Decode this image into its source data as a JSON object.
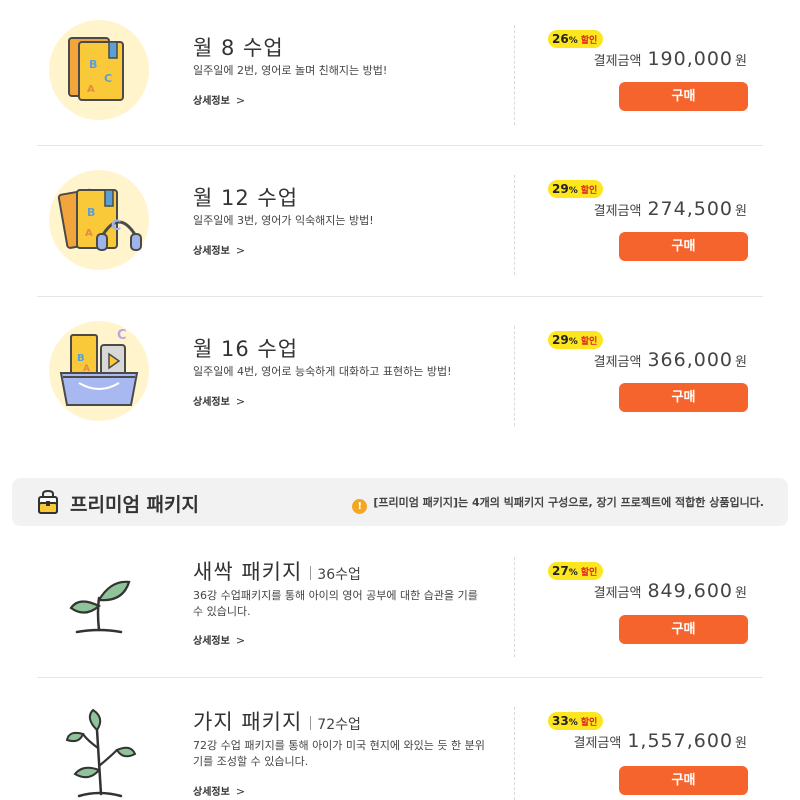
{
  "products": [
    {
      "title": "월 8 수업",
      "description": "일주일에 2번, 영어로 놀며 친해지는 방법!",
      "detail_label": "상세정보",
      "discount_value": "26",
      "discount_unit": "%",
      "discount_label": "할인",
      "price_label": "결제금액",
      "price": "190,000",
      "currency": "원",
      "buy_label": "구매",
      "icon": "books-icon"
    },
    {
      "title": "월 12 수업",
      "description": "일주일에 3번, 영어가 익숙해지는 방법!",
      "detail_label": "상세정보",
      "discount_value": "29",
      "discount_unit": "%",
      "discount_label": "할인",
      "price_label": "결제금액",
      "price": "274,500",
      "currency": "원",
      "buy_label": "구매",
      "icon": "books-headphones-icon"
    },
    {
      "title": "월 16 수업",
      "description": "일주일에 4번, 영어로 능숙하게 대화하고 표현하는 방법!",
      "detail_label": "상세정보",
      "discount_value": "29",
      "discount_unit": "%",
      "discount_label": "할인",
      "price_label": "결제금액",
      "price": "366,000",
      "currency": "원",
      "buy_label": "구매",
      "icon": "learning-basket-icon"
    }
  ],
  "premium": {
    "title": "프리미엄 패키지",
    "notice": "[프리미엄 패키지]는 4개의 빅패키지 구성으로, 장기 프로젝트에 적합한 상품입니다.",
    "icon": "premium-bag-icon",
    "notice_icon": "warning-icon"
  },
  "packages": [
    {
      "title": "새싹 패키지",
      "lessons": "36수업",
      "description": "36강 수업패키지를 통해 아이의 영어 공부에 대한 습관을 기를 수 있습니다.",
      "detail_label": "상세정보",
      "discount_value": "27",
      "discount_unit": "%",
      "discount_label": "할인",
      "price_label": "결제금액",
      "price": "849,600",
      "currency": "원",
      "buy_label": "구매",
      "icon": "sprout-icon"
    },
    {
      "title": "가지 패키지",
      "lessons": "72수업",
      "description": "72강 수업 패키지를 통해 아이가 미국 현지에 와있는 듯 한 분위기를 조성할 수 있습니다.",
      "detail_label": "상세정보",
      "discount_value": "33",
      "discount_unit": "%",
      "discount_label": "할인",
      "price_label": "결제금액",
      "price": "1,557,600",
      "currency": "원",
      "buy_label": "구매",
      "icon": "branch-icon"
    }
  ],
  "colors": {
    "buy_button": "#f6642d",
    "discount_badge": "#fde61f",
    "thumb_background": "#fff4cc",
    "premium_bar": "#f2f2f2"
  }
}
